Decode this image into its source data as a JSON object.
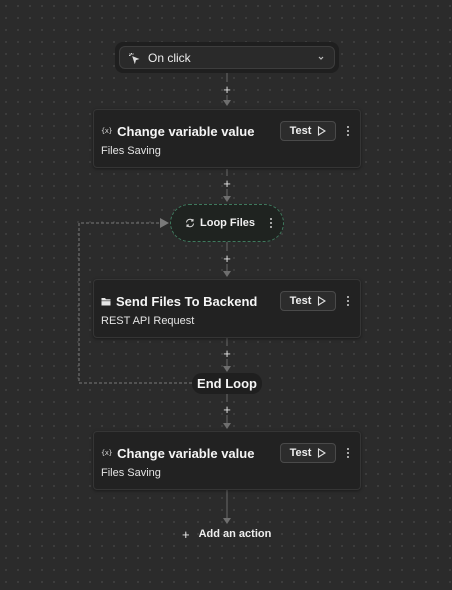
{
  "trigger": {
    "label": "On click",
    "icon": "pointer-click-icon",
    "dropdown_icon": "chevron-down-icon"
  },
  "steps": [
    {
      "title": "Change variable value",
      "subtitle": "Files Saving",
      "icon": "variable-icon",
      "test_label": "Test"
    },
    {
      "title": "Send Files To Backend",
      "subtitle": "REST API Request",
      "icon": "folder-icon",
      "test_label": "Test"
    },
    {
      "title": "Change variable value",
      "subtitle": "Files Saving",
      "icon": "variable-icon",
      "test_label": "Test"
    }
  ],
  "variable_icon_text": "{x}",
  "loop": {
    "label": "Loop Files",
    "end_label": "End Loop",
    "icon": "repeat-icon"
  },
  "add_action": {
    "label": "Add an action"
  },
  "insert_symbol": "+",
  "colors": {
    "canvas": "#2b2b2b",
    "card": "#222222",
    "connector": "#6e6e6e",
    "loop_border": "#3f7a5e"
  }
}
